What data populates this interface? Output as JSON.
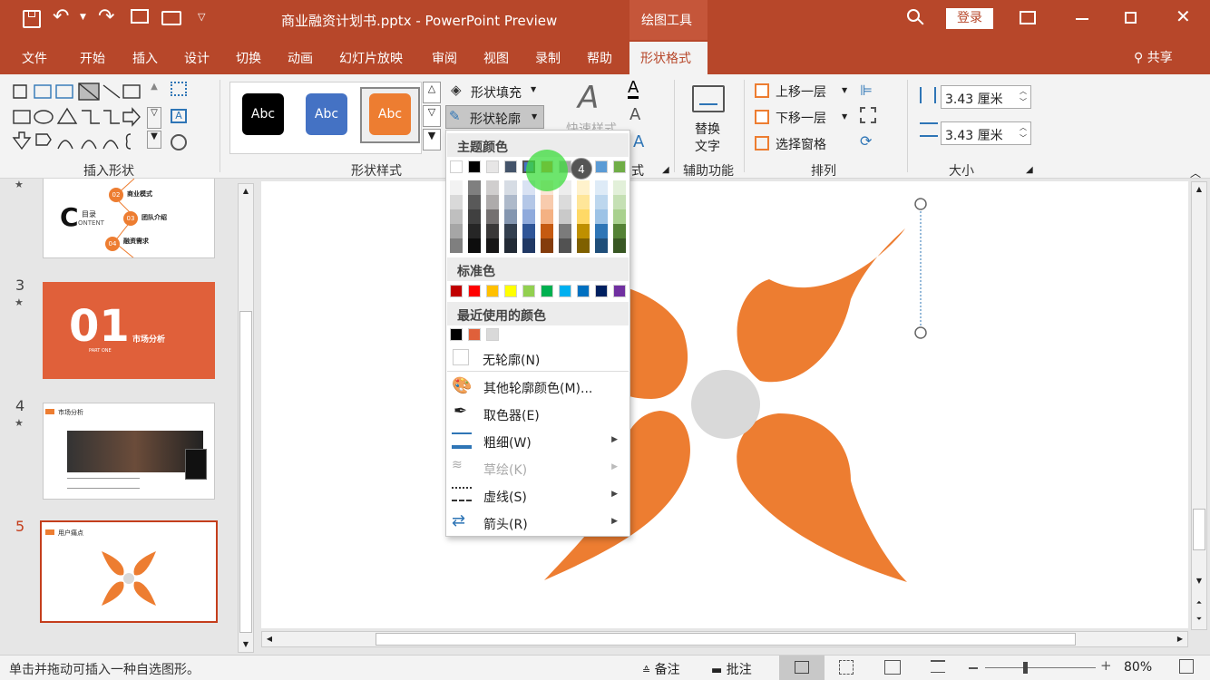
{
  "titlebar": {
    "file_title": "商业融资计划书.pptx - PowerPoint Preview",
    "context_tab": "绘图工具",
    "login": "登录"
  },
  "tabs": [
    {
      "label": "文件"
    },
    {
      "label": "开始"
    },
    {
      "label": "插入"
    },
    {
      "label": "设计"
    },
    {
      "label": "切换"
    },
    {
      "label": "动画"
    },
    {
      "label": "幻灯片放映"
    },
    {
      "label": "审阅"
    },
    {
      "label": "视图"
    },
    {
      "label": "录制"
    },
    {
      "label": "帮助"
    },
    {
      "label": "形状格式"
    }
  ],
  "share": "共享",
  "ribbon": {
    "insert_shapes_label": "插入形状",
    "shape_styles_label": "形状样式",
    "style_presets": [
      {
        "text": "Abc",
        "color": "#000000"
      },
      {
        "text": "Abc",
        "color": "#4472c4"
      },
      {
        "text": "Abc",
        "color": "#ed7d31"
      }
    ],
    "shape_fill": "形状填充",
    "shape_outline": "形状轮廓",
    "quick_styles": "快速样式",
    "art_label": "式",
    "alt_text_l1": "替换",
    "alt_text_l2": "文字",
    "accessibility_label": "辅助功能",
    "bring_forward": "上移一层",
    "send_backward": "下移一层",
    "selection_pane": "选择窗格",
    "arrange_label": "排列",
    "height_value": "3.43 厘米",
    "width_value": "3.43 厘米",
    "size_label": "大小"
  },
  "dropdown": {
    "theme_colors_header": "主题颜色",
    "standard_colors_header": "标准色",
    "recent_colors_header": "最近使用的颜色",
    "theme_top": [
      "#ffffff",
      "#000000",
      "#e7e6e6",
      "#44546a",
      "#4472c4",
      "#ed7d31",
      "#a5a5a5",
      "#ffc000",
      "#5b9bd5",
      "#70ad47"
    ],
    "theme_shades": [
      [
        "#f2f2f2",
        "#d9d9d9",
        "#bfbfbf",
        "#a6a6a6",
        "#7f7f7f"
      ],
      [
        "#7f7f7f",
        "#595959",
        "#404040",
        "#262626",
        "#0d0d0d"
      ],
      [
        "#d0cece",
        "#aeabab",
        "#757171",
        "#3a3838",
        "#171616"
      ],
      [
        "#d6dce4",
        "#adb9ca",
        "#8496b0",
        "#333f4f",
        "#222a35"
      ],
      [
        "#d9e2f3",
        "#b4c7e7",
        "#8faadc",
        "#2f5597",
        "#203864"
      ],
      [
        "#fbe5d6",
        "#f8cbad",
        "#f4b183",
        "#c55a11",
        "#843c0c"
      ],
      [
        "#ededed",
        "#dbdbdb",
        "#c9c9c9",
        "#7b7b7b",
        "#525252"
      ],
      [
        "#fff2cc",
        "#ffe699",
        "#ffd966",
        "#bf9000",
        "#7f6000"
      ],
      [
        "#deebf7",
        "#bdd7ee",
        "#9dc3e6",
        "#2e75b6",
        "#1f4e79"
      ],
      [
        "#e2f0d9",
        "#c5e0b4",
        "#a9d18e",
        "#548235",
        "#385723"
      ]
    ],
    "standard": [
      "#c00000",
      "#ff0000",
      "#ffc000",
      "#ffff00",
      "#92d050",
      "#00b050",
      "#00b0f0",
      "#0070c0",
      "#002060",
      "#7030a0"
    ],
    "recent": [
      "#000000",
      "#e0603a",
      "#d9d9d9"
    ],
    "no_outline": "无轮廓(N)",
    "more_colors": "其他轮廓颜色(M)...",
    "eyedropper": "取色器(E)",
    "weight": "粗细(W)",
    "sketched": "草绘(K)",
    "dashes": "虚线(S)",
    "arrows": "箭头(R)",
    "highlight_badge": "4"
  },
  "slides": [
    {
      "number": "3",
      "title": "01",
      "subtitle": "市场分析",
      "tag": "PART ONE"
    },
    {
      "number": "4",
      "title": "市场分析"
    },
    {
      "number": "5",
      "title": "用户痛点"
    }
  ],
  "slide2": {
    "big_letter": "C",
    "label1": "目录",
    "label2": "ONTENT",
    "items": [
      {
        "num": "02",
        "text": "商业模式"
      },
      {
        "num": "03",
        "text": "团队介绍"
      },
      {
        "num": "04",
        "text": "融资需求"
      }
    ]
  },
  "status": {
    "hint": "单击并拖动可插入一种自选图形。",
    "notes": "备注",
    "comments": "批注",
    "zoom": "80%"
  },
  "colors": {
    "accent": "#b7472a",
    "shape_orange": "#ed7d31",
    "center_gray": "#d9d9d9",
    "highlight_green": "#3cdc3c"
  }
}
